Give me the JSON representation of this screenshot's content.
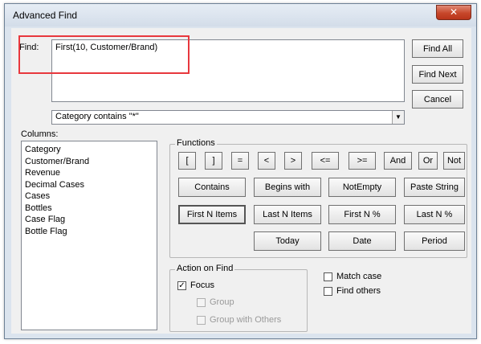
{
  "window": {
    "title": "Advanced Find",
    "close_glyph": "✕"
  },
  "find": {
    "label": "Find:",
    "value": "First(10, Customer/Brand)",
    "combo_value": "Category contains \"*\""
  },
  "buttons": {
    "find_all": "Find All",
    "find_next": "Find Next",
    "cancel": "Cancel"
  },
  "columns": {
    "label": "Columns:",
    "items": [
      "Category",
      "Customer/Brand",
      "Revenue",
      "Decimal Cases",
      "Cases",
      "Bottles",
      "Case Flag",
      "Bottle Flag"
    ]
  },
  "functions": {
    "label": "Functions",
    "row1": [
      "[",
      "]",
      "=",
      "<",
      ">",
      "<=",
      ">=",
      "And",
      "Or",
      "Not"
    ],
    "row2": [
      "Contains",
      "Begins with",
      "NotEmpty",
      "Paste String"
    ],
    "row3": [
      "First N Items",
      "Last N Items",
      "First N %",
      "Last N %"
    ],
    "row4": [
      "Today",
      "Date",
      "Period"
    ]
  },
  "action_on_find": {
    "label": "Action on Find",
    "focus": "Focus",
    "group": "Group",
    "group_with_others": "Group with Others",
    "focus_checked": true
  },
  "options": {
    "match_case": "Match case",
    "find_others": "Find others"
  },
  "icons": {
    "close": "close-icon",
    "dropdown": "chevron-down-icon",
    "check": "check-icon"
  },
  "colors": {
    "highlight": "#e8383d",
    "close_button": "#c7472b"
  }
}
